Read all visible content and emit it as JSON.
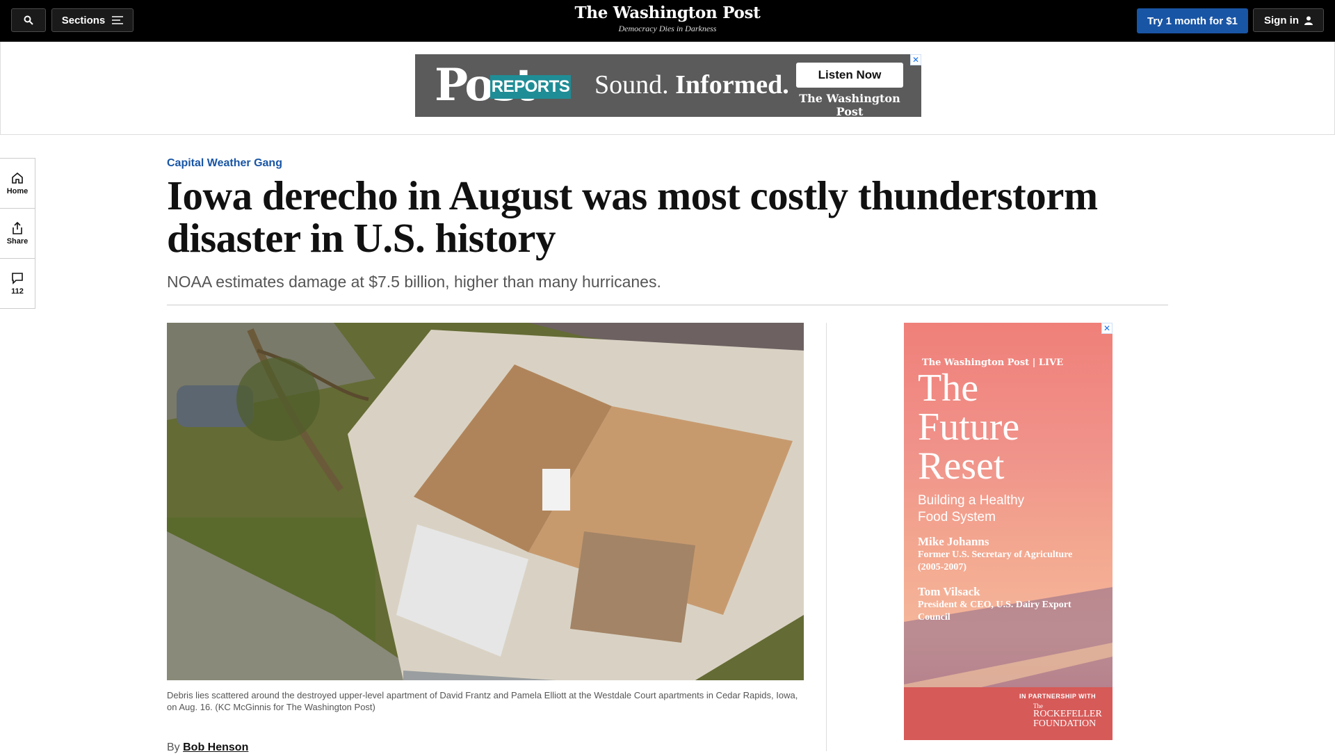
{
  "nav": {
    "sections_label": "Sections",
    "logo": "The Washington Post",
    "tagline": "Democracy Dies in Darkness",
    "try_label": "Try 1 month for $1",
    "signin_label": "Sign in"
  },
  "banner_ad": {
    "post": "Post",
    "reports": "REPORTS",
    "slogan_a": "Sound.",
    "slogan_b": "Informed.",
    "cta": "Listen Now",
    "brand": "The Washington Post"
  },
  "rail": {
    "home": "Home",
    "share": "Share",
    "comments": "112"
  },
  "article": {
    "kicker": "Capital Weather Gang",
    "headline": "Iowa derecho in August was most costly thunderstorm disaster in U.S. history",
    "dek": "NOAA estimates damage at $7.5 billion, higher than many hurricanes.",
    "caption": "Debris lies scattered around the destroyed upper-level apartment of David Frantz and Pamela Elliott at the Westdale Court apartments in Cedar Rapids, Iowa, on Aug. 16. (KC McGinnis for The Washington Post)",
    "byline_prefix": "By",
    "author": "Bob Henson"
  },
  "side_ad": {
    "brand": "The Washington Post | LIVE",
    "title_1": "The",
    "title_2": "Future",
    "title_3": "Reset",
    "sub": "Building a Healthy Food System",
    "speaker1_name": "Mike Johanns",
    "speaker1_title": "Former U.S. Secretary of Agriculture (2005-2007)",
    "speaker2_name": "Tom Vilsack",
    "speaker2_title": "President & CEO, U.S. Dairy Export Council",
    "partner": "IN PARTNERSHIP WITH",
    "sponsor_the": "The",
    "sponsor_1": "ROCKEFELLER",
    "sponsor_2": "FOUNDATION"
  },
  "colors": {
    "accent": "#1955a5",
    "nav_bg": "#000000"
  }
}
